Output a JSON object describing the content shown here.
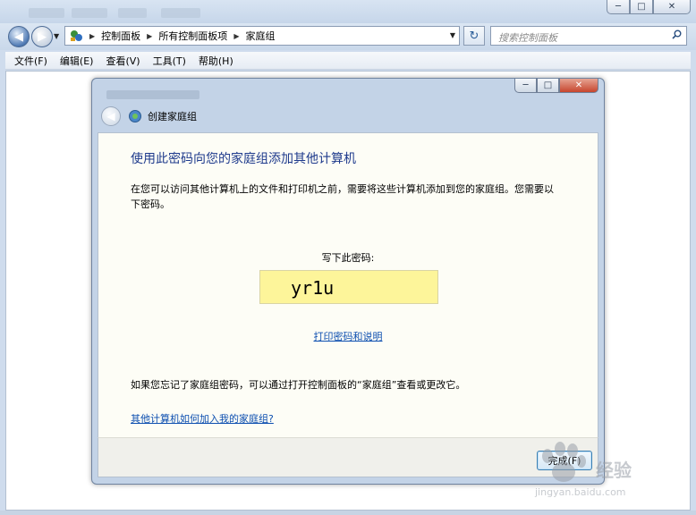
{
  "address": {
    "crumbs": [
      "控制面板",
      "所有控制面板项",
      "家庭组"
    ],
    "search_placeholder": "搜索控制面板"
  },
  "menu": [
    "文件(F)",
    "编辑(E)",
    "查看(V)",
    "工具(T)",
    "帮助(H)"
  ],
  "dialog": {
    "title": "创建家庭组",
    "heading": "使用此密码向您的家庭组添加其他计算机",
    "description": "在您可以访问其他计算机上的文件和打印机之前，需要将这些计算机添加到您的家庭组。您需要以下密码。",
    "password_label": "写下此密码:",
    "password": "yr1u",
    "print_link": "打印密码和说明",
    "forgot_text": "如果您忘记了家庭组密码，可以通过打开控制面板的“家庭组”查看或更改它。",
    "join_link": "其他计算机如何加入我的家庭组?",
    "finish_button": "完成(F)"
  },
  "watermark": {
    "text": "经验",
    "url": "jingyan.baidu.com"
  }
}
